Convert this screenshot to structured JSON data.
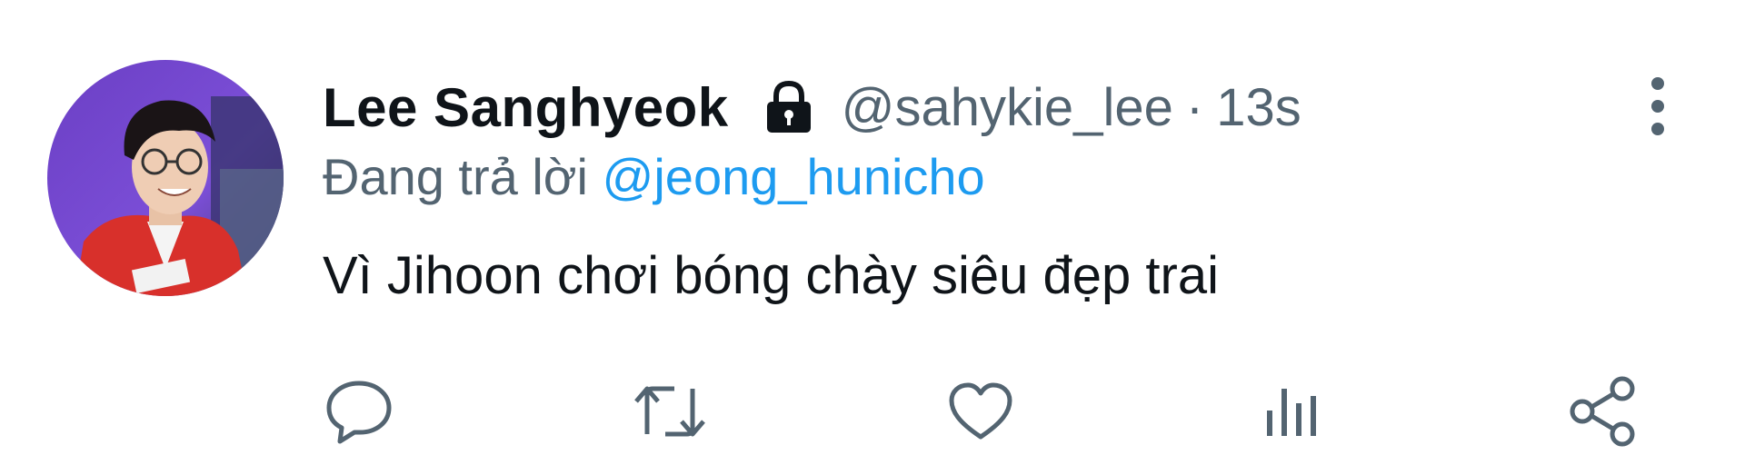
{
  "tweet": {
    "author": {
      "display_name": "Lee Sanghyeok",
      "handle": "@sahykie_lee",
      "protected_icon": "lock-icon",
      "avatar": "profile-photo"
    },
    "separator": "·",
    "timestamp": "13s",
    "reply_prefix": "Đang trả lời",
    "reply_to": "@jeong_hunicho",
    "text": "Vì Jihoon chơi bóng chày siêu đẹp trai",
    "more_icon": "more-vertical-icon",
    "actions": [
      {
        "name": "reply",
        "icon": "comment-bubble-icon"
      },
      {
        "name": "retweet",
        "icon": "retweet-arrows-icon"
      },
      {
        "name": "like",
        "icon": "heart-icon"
      },
      {
        "name": "views",
        "icon": "bar-chart-icon"
      },
      {
        "name": "share",
        "icon": "share-nodes-icon"
      }
    ],
    "colors": {
      "text_primary": "#0f1419",
      "text_secondary": "#536471",
      "mention": "#1d9bf0",
      "icon": "#536471"
    }
  }
}
